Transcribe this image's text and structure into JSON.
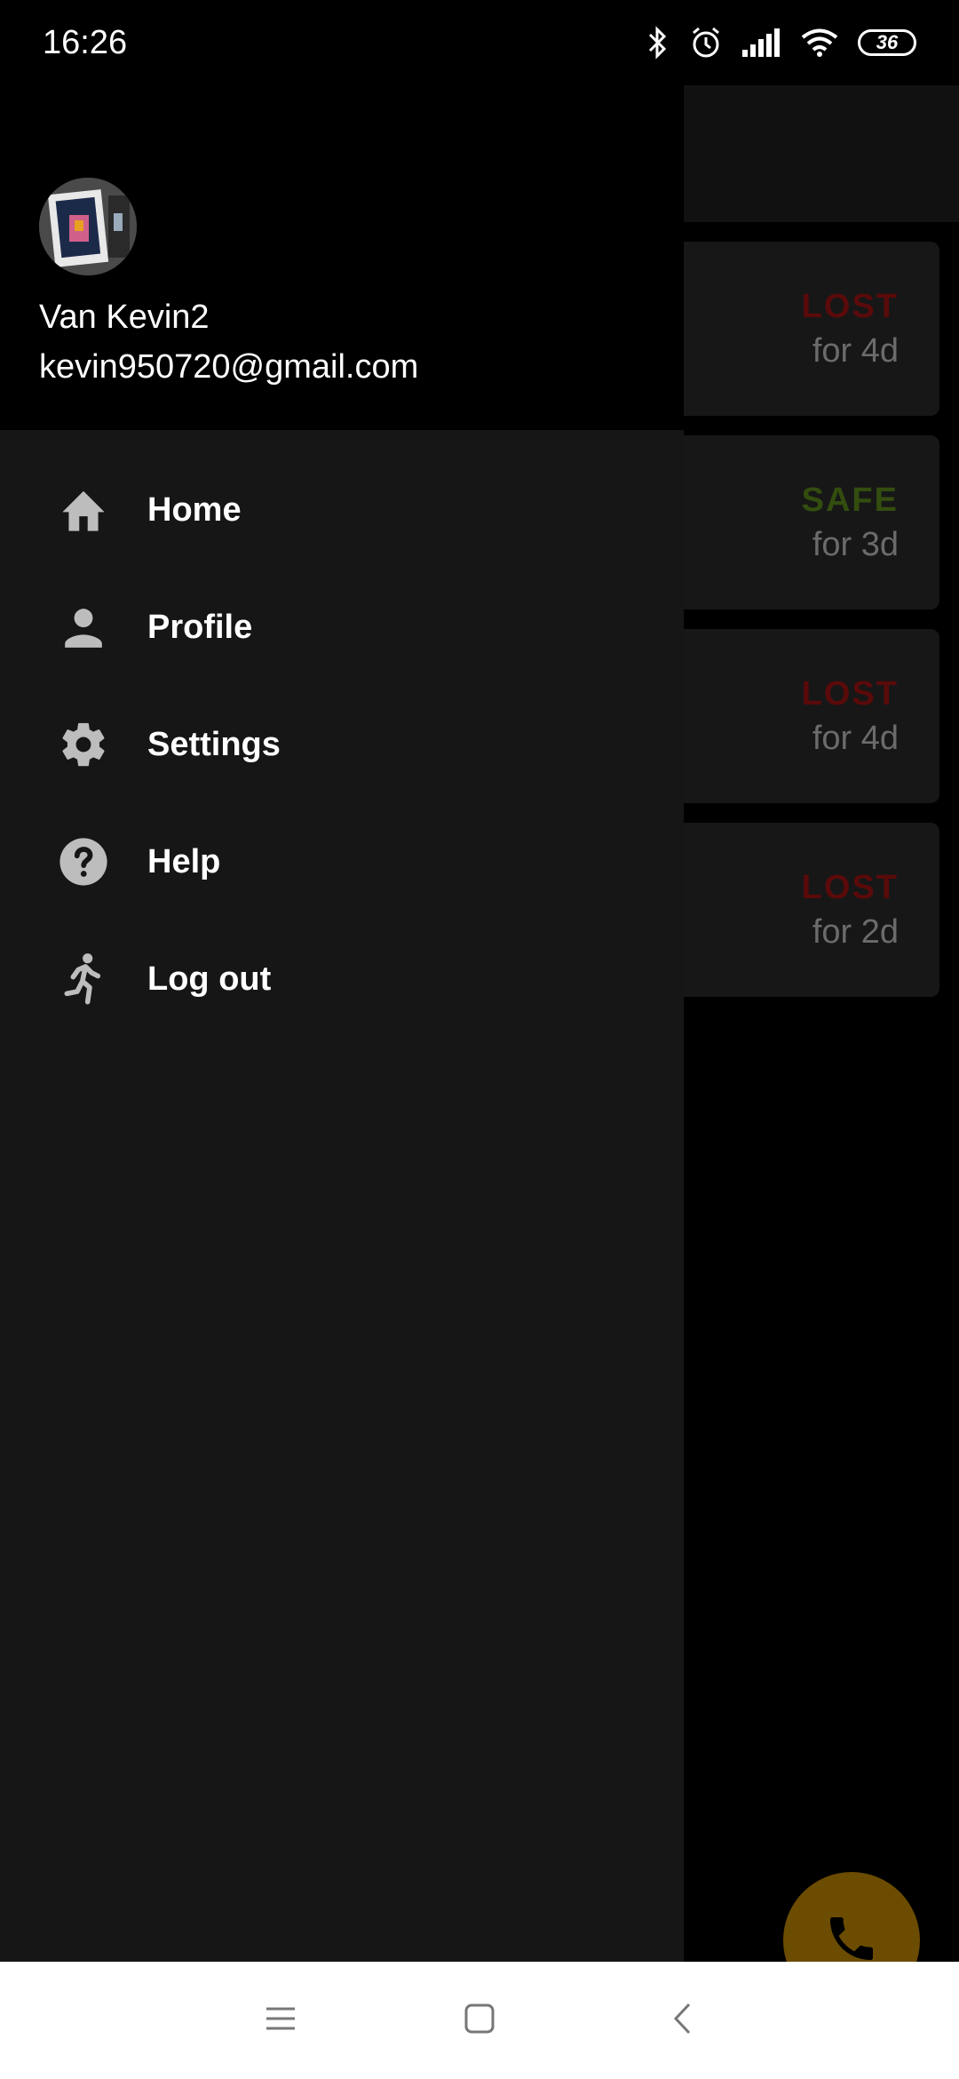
{
  "status_bar": {
    "time": "16:26",
    "battery": "36",
    "icons": [
      "bluetooth-icon",
      "alarm-icon",
      "signal-icon",
      "wifi-icon",
      "battery-icon"
    ]
  },
  "drawer": {
    "user": {
      "name": "Van Kevin2",
      "email": "kevin950720@gmail.com"
    },
    "items": [
      {
        "label": "Home",
        "icon": "home-icon"
      },
      {
        "label": "Profile",
        "icon": "person-icon"
      },
      {
        "label": "Settings",
        "icon": "gear-icon"
      },
      {
        "label": "Help",
        "icon": "help-icon"
      },
      {
        "label": "Log out",
        "icon": "running-person-icon"
      }
    ]
  },
  "background_list": {
    "cards": [
      {
        "status": "LOST",
        "duration": "for 4d",
        "color": "#5a0a0a"
      },
      {
        "status": "SAFE",
        "duration": "for 3d",
        "color": "#334d0f"
      },
      {
        "status": "LOST",
        "duration": "for 4d",
        "color": "#5a0a0a"
      },
      {
        "status": "LOST",
        "duration": "for 2d",
        "color": "#5a0a0a"
      }
    ],
    "fab_icon": "phone-icon",
    "fab_color": "#6b4c00"
  },
  "nav_bar": {
    "buttons": [
      "menu-icon",
      "home-square-icon",
      "back-icon"
    ]
  }
}
